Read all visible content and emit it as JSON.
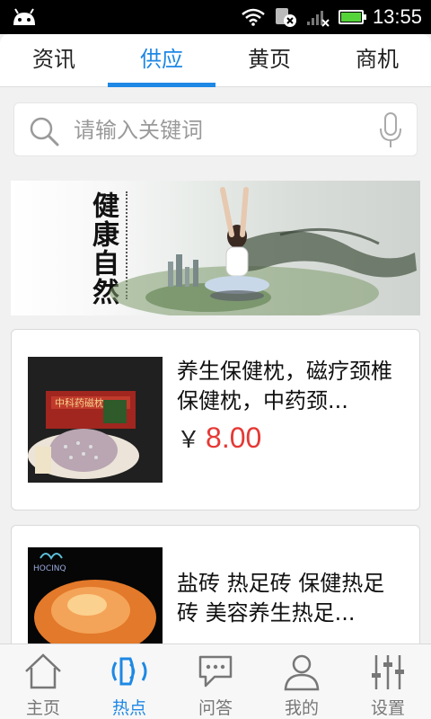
{
  "status_bar": {
    "time": "13:55",
    "battery_color": "#55d43a"
  },
  "tabs": [
    {
      "label": "资讯"
    },
    {
      "label": "供应"
    },
    {
      "label": "黄页"
    },
    {
      "label": "商机"
    }
  ],
  "active_tab": "供应",
  "accent_color": "#1e88e5",
  "price_color": "#e53935",
  "search": {
    "placeholder": "请输入关键词",
    "value": ""
  },
  "banner": {
    "calligraphy": "健康自然"
  },
  "products": [
    {
      "title": "养生保健枕，磁疗颈椎保健枕，中药颈...",
      "currency": "￥",
      "price": "8.00"
    },
    {
      "title": "盐砖 热足砖 保健热足砖 美容养生热足..."
    }
  ],
  "bottom_nav": [
    {
      "label": "主页",
      "icon": "home-icon"
    },
    {
      "label": "热点",
      "icon": "broadcast-icon"
    },
    {
      "label": "问答",
      "icon": "chat-icon"
    },
    {
      "label": "我的",
      "icon": "user-icon"
    },
    {
      "label": "设置",
      "icon": "sliders-icon"
    }
  ],
  "active_nav": "热点"
}
